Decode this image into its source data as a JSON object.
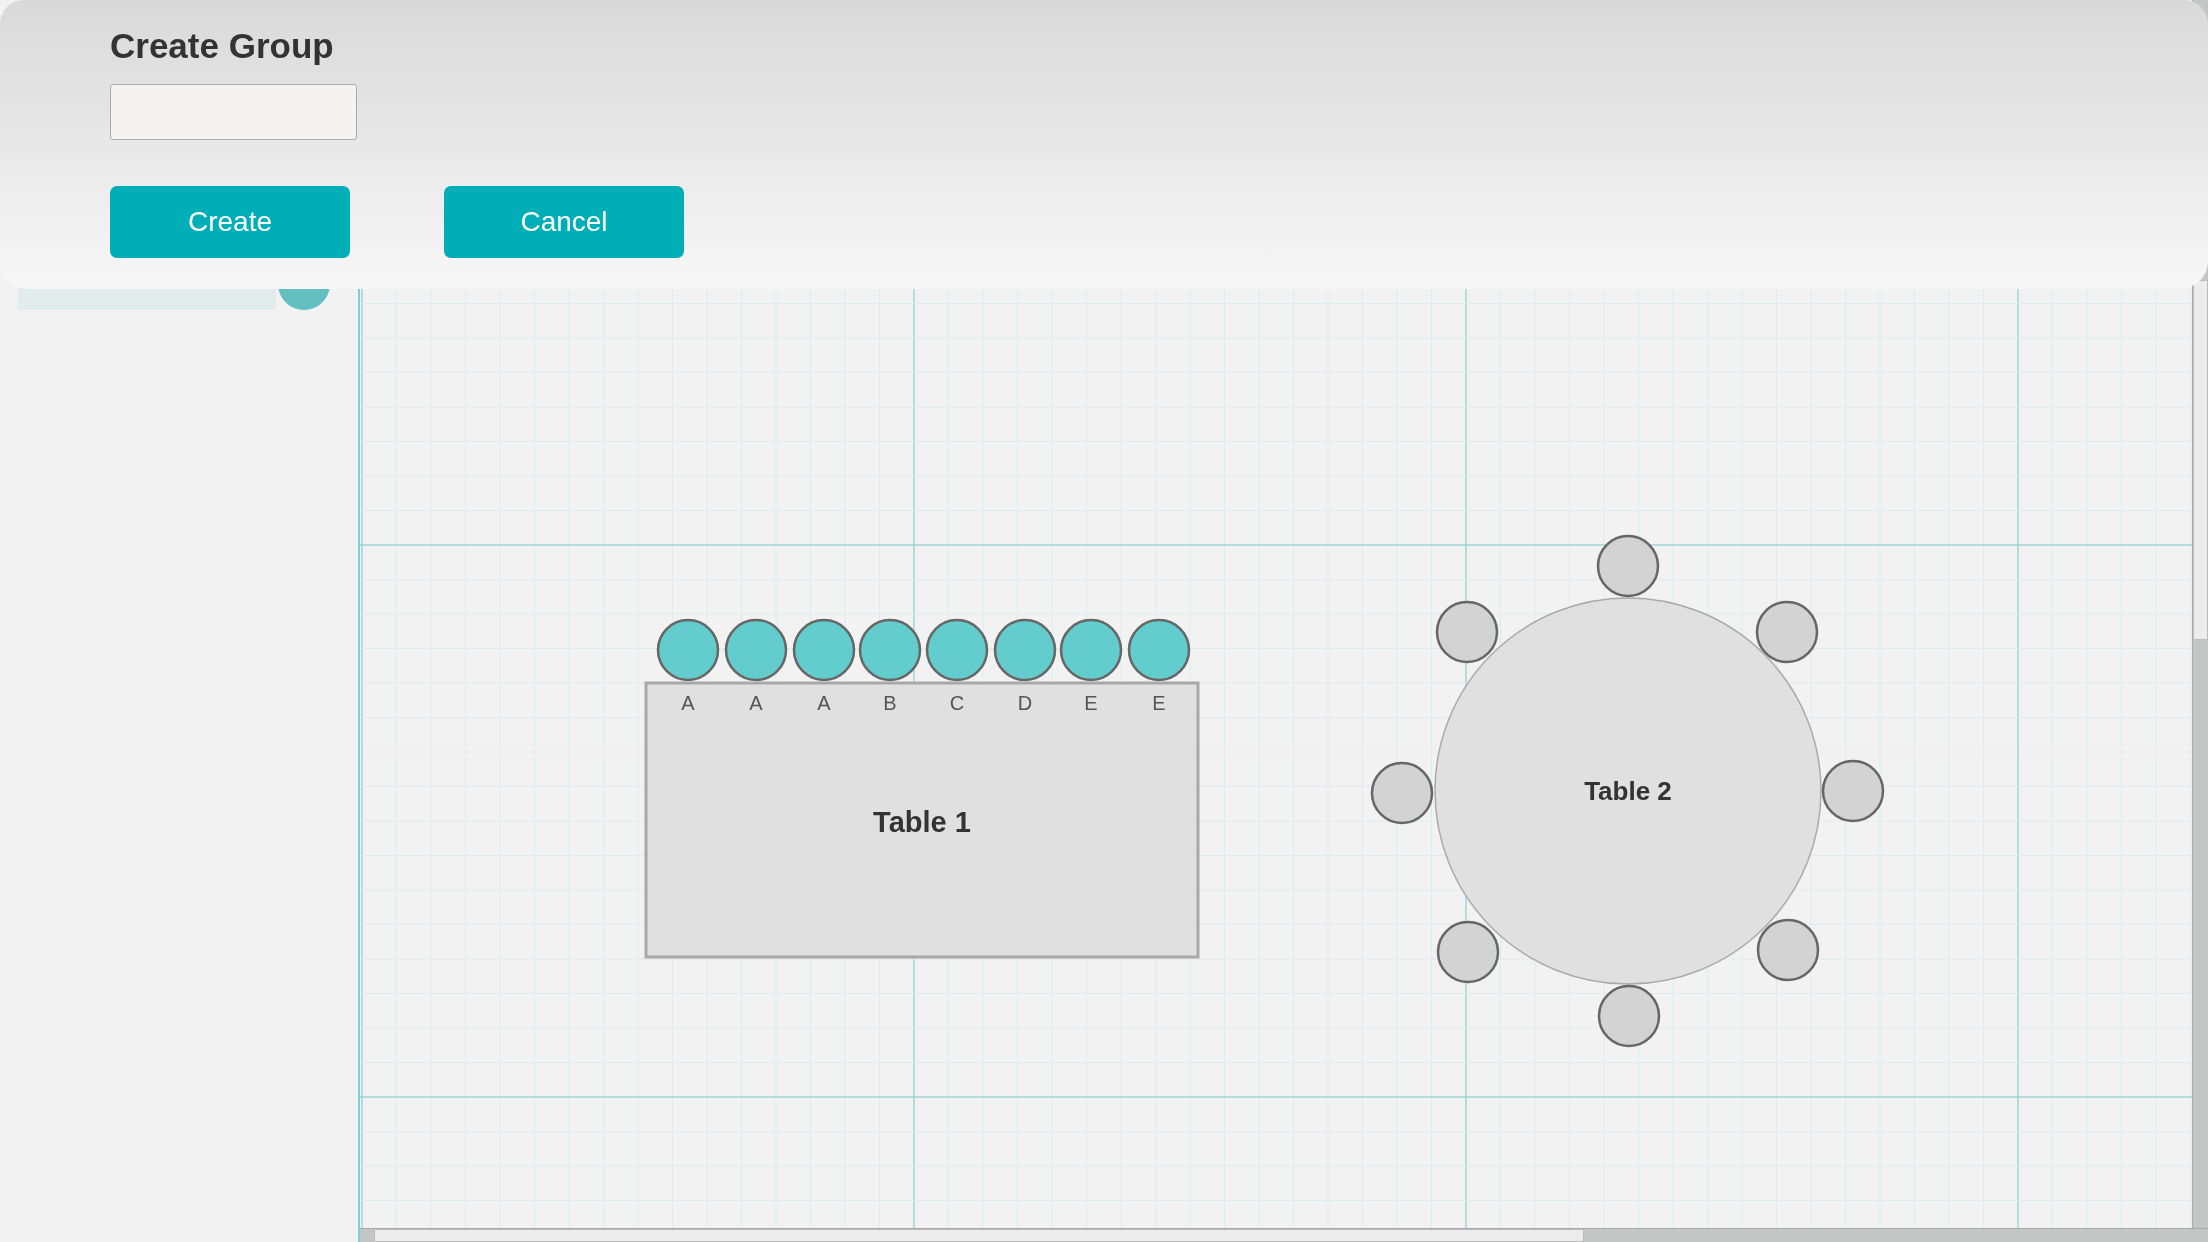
{
  "dialog": {
    "title": "Create Group",
    "buttons": [
      {
        "label": "Create"
      },
      {
        "label": "Cancel"
      }
    ]
  },
  "tables": [
    {
      "kind": "rect",
      "label": "Table 1",
      "seats": [
        {
          "label": "A",
          "assigned": true
        },
        {
          "label": "A",
          "assigned": true
        },
        {
          "label": "A",
          "assigned": true
        },
        {
          "label": "B",
          "assigned": true
        },
        {
          "label": "C",
          "assigned": true
        },
        {
          "label": "D",
          "assigned": true
        },
        {
          "label": "E",
          "assigned": true
        },
        {
          "label": "E",
          "assigned": true
        }
      ]
    },
    {
      "kind": "round",
      "label": "Table 2",
      "seats": [
        {
          "assigned": false
        },
        {
          "assigned": false
        },
        {
          "assigned": false
        },
        {
          "assigned": false
        },
        {
          "assigned": false
        },
        {
          "assigned": false
        },
        {
          "assigned": false
        },
        {
          "assigned": false
        }
      ]
    }
  ]
}
